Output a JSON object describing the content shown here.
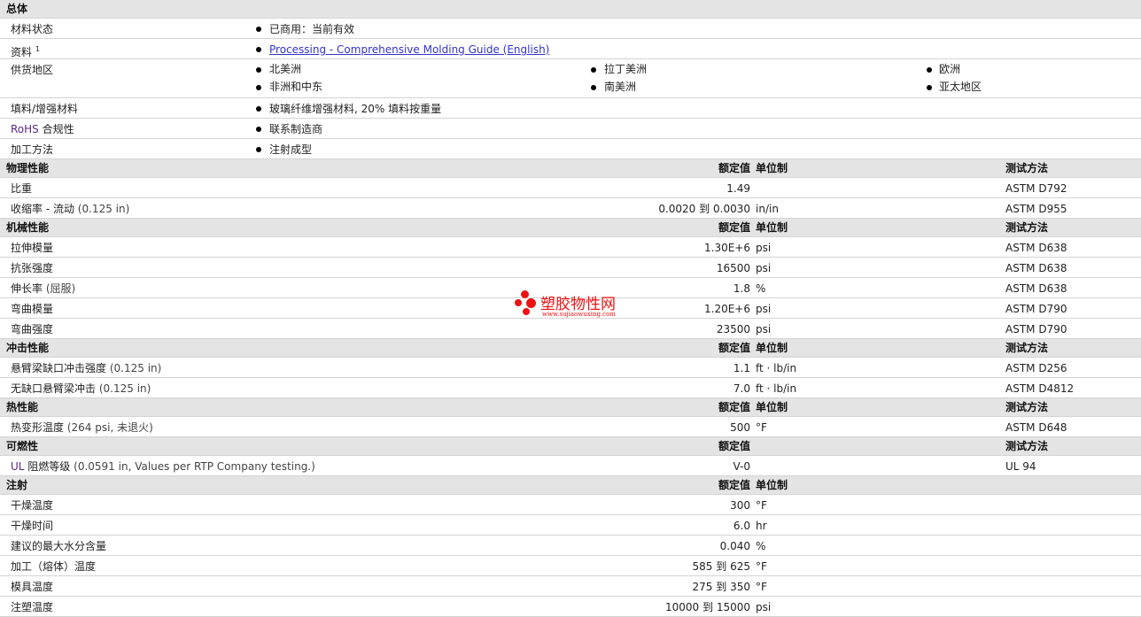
{
  "sections": {
    "general": {
      "title": "总体",
      "status_label": "材料状态",
      "status_value": "已商用：当前有效",
      "docs_label": "资料",
      "docs_sup": "1",
      "docs_link": "Processing - Comprehensive Molding Guide (English)",
      "regions_label": "供货地区",
      "regions": [
        "北美洲",
        "拉丁美洲",
        "欧洲",
        "非洲和中东",
        "南美洲",
        "亚太地区"
      ],
      "filler_label": "填料/增强材料",
      "filler_value": "玻璃纤维增强材料, 20% 填料按重量",
      "rohs_label_a": "RoHS",
      "rohs_label_b": "合规性",
      "rohs_value": "联系制造商",
      "process_label": "加工方法",
      "process_value": "注射成型"
    },
    "physical": {
      "title": "物理性能",
      "col_value": "额定值",
      "col_unit": "单位制",
      "col_method": "测试方法",
      "rows": [
        {
          "name": "比重",
          "cond": "",
          "value": "1.49",
          "unit": "",
          "method": "ASTM D792"
        },
        {
          "name": "收缩率 - 流动",
          "cond": "(0.125 in)",
          "v1": "0.0020",
          "to": "到",
          "v2": "0.0030",
          "unit": "in/in",
          "method": "ASTM D955"
        }
      ]
    },
    "mechanical": {
      "title": "机械性能",
      "col_value": "额定值",
      "col_unit": "单位制",
      "col_method": "测试方法",
      "rows": [
        {
          "name": "拉伸模量",
          "value": "1.30E+6",
          "unit": "psi",
          "method": "ASTM D638"
        },
        {
          "name": "抗张强度",
          "value": "16500",
          "unit": "psi",
          "method": "ASTM D638"
        },
        {
          "name": "伸长率",
          "cond": "(屈服)",
          "value": "1.8",
          "unit": "%",
          "method": "ASTM D638"
        },
        {
          "name": "弯曲模量",
          "value": "1.20E+6",
          "unit": "psi",
          "method": "ASTM D790"
        },
        {
          "name": "弯曲强度",
          "value": "23500",
          "unit": "psi",
          "method": "ASTM D790"
        }
      ]
    },
    "impact": {
      "title": "冲击性能",
      "col_value": "额定值",
      "col_unit": "单位制",
      "col_method": "测试方法",
      "rows": [
        {
          "name": "悬臂梁缺口冲击强度",
          "cond": "(0.125 in)",
          "value": "1.1",
          "unit": "ft · lb/in",
          "method": "ASTM D256"
        },
        {
          "name": "无缺口悬臂梁冲击",
          "cond": "(0.125 in)",
          "value": "7.0",
          "unit": "ft · lb/in",
          "method": "ASTM D4812"
        }
      ]
    },
    "thermal": {
      "title": "热性能",
      "col_value": "额定值",
      "col_unit": "单位制",
      "col_method": "测试方法",
      "rows": [
        {
          "name": "热变形温度",
          "cond": "(264 psi, 未退火)",
          "value": "500",
          "unit": "°F",
          "method": "ASTM D648"
        }
      ]
    },
    "flammability": {
      "title": "可燃性",
      "col_value": "额定值",
      "col_method": "测试方法",
      "rows": [
        {
          "name_a": "UL",
          "name_b": "阻燃等级",
          "cond": "(0.0591 in, Values per RTP Company testing.)",
          "value": "V-0",
          "method": "UL 94"
        }
      ]
    },
    "injection": {
      "title": "注射",
      "col_value": "额定值",
      "col_unit": "单位制",
      "rows": [
        {
          "name": "干燥温度",
          "value": "300",
          "unit": "°F"
        },
        {
          "name": "干燥时间",
          "value": "6.0",
          "unit": "hr"
        },
        {
          "name": "建议的最大水分含量",
          "value": "0.040",
          "unit": "%"
        },
        {
          "name": "加工（熔体）温度",
          "v1": "585",
          "to": "到",
          "v2": "625",
          "unit": "°F"
        },
        {
          "name": "模具温度",
          "v1": "275",
          "to": "到",
          "v2": "350",
          "unit": "°F"
        },
        {
          "name": "注塑温度",
          "v1": "10000",
          "to": "到",
          "v2": "15000",
          "unit": "psi"
        }
      ]
    }
  },
  "watermark": {
    "title": "塑胶物性网",
    "url": "www.sujiaowuxing.com",
    "color": "#e11111"
  }
}
